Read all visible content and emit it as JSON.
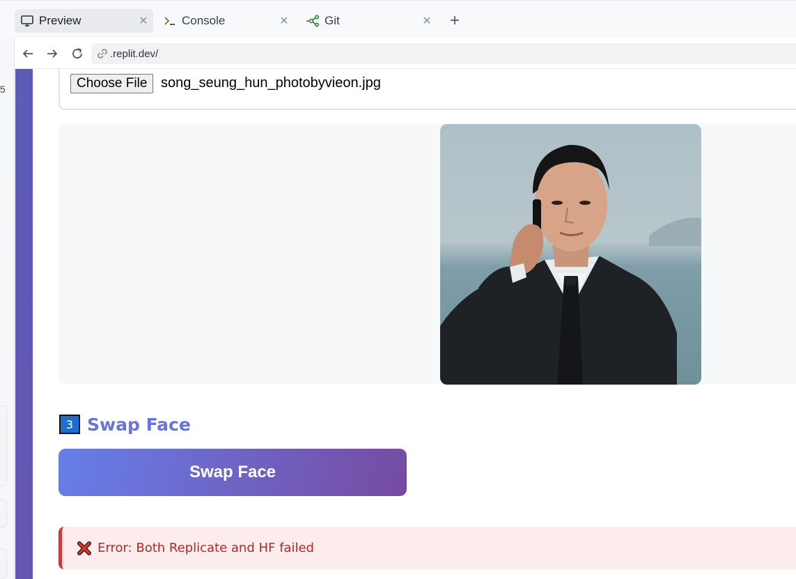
{
  "tabs": [
    {
      "label": "Preview",
      "icon": "monitor-icon",
      "active": true
    },
    {
      "label": "Console",
      "icon": "terminal-icon",
      "active": false
    },
    {
      "label": "Git",
      "icon": "git-icon",
      "active": false
    }
  ],
  "address_bar": {
    "url": ".replit.dev/"
  },
  "outer": {
    "glyph": "5"
  },
  "upload": {
    "button_label": "Choose File",
    "file_name": "song_seung_hun_photobyvieon.jpg"
  },
  "step": {
    "number": "3",
    "title": "Swap Face"
  },
  "swap_button": {
    "label": "Swap Face"
  },
  "error": {
    "message": "Error: Both Replicate and HF failed"
  },
  "colors": {
    "accent": "#6673e0",
    "button_gradient_start": "#667eea",
    "button_gradient_end": "#764ba2",
    "error_text": "#b02a2a",
    "error_bg": "#fdecec",
    "error_border": "#cf3a3a"
  }
}
